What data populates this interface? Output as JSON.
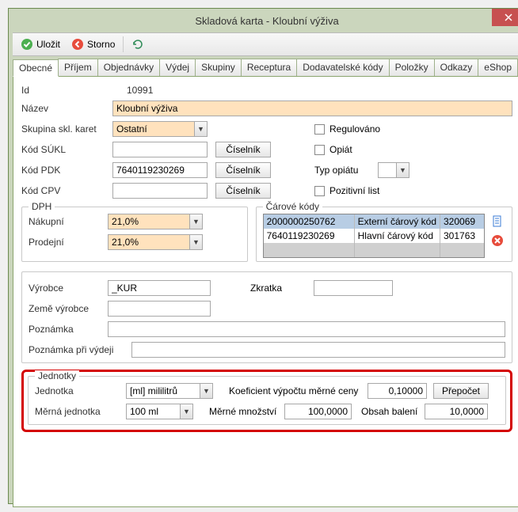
{
  "window": {
    "title": "Skladová karta - Kloubní výživa"
  },
  "toolbar": {
    "save": "Uložit",
    "cancel": "Storno"
  },
  "tabs": [
    "Obecné",
    "Příjem",
    "Objednávky",
    "Výdej",
    "Skupiny",
    "Receptura",
    "Dodavatelské kódy",
    "Položky",
    "Odkazy",
    "eShop"
  ],
  "labels": {
    "id": "Id",
    "nazev": "Název",
    "skupina": "Skupina skl. karet",
    "kodSukl": "Kód SÚKL",
    "kodPdk": "Kód PDK",
    "kodCpv": "Kód CPV",
    "ciselnik": "Číselník",
    "regulovano": "Regulováno",
    "opiat": "Opiát",
    "typOpiatu": "Typ opiátu",
    "pozList": "Pozitivní list",
    "dph": "DPH",
    "nakupni": "Nákupní",
    "prodejni": "Prodejní",
    "carove": "Čárové kódy",
    "vyrobce": "Výrobce",
    "zkratka": "Zkratka",
    "zemeVyrobce": "Země výrobce",
    "poznamka": "Poznámka",
    "poznamkaVydej": "Poznámka při výdeji",
    "jednotky": "Jednotky",
    "jednotka": "Jednotka",
    "koef": "Koeficient výpočtu měrné ceny",
    "prepocet": "Přepočet",
    "mernaJednotka": "Měrná jednotka",
    "merneMnozstvi": "Měrné množství",
    "obsahBaleni": "Obsah balení"
  },
  "values": {
    "id": "10991",
    "nazev": "Kloubní výživa",
    "skupina": "Ostatní",
    "kodSukl": "",
    "kodPdk": "7640119230269",
    "kodCpv": "",
    "typOpiatu": "",
    "dphNakupni": "21,0%",
    "dphProdejni": "21,0%",
    "vyrobce": "_KUR",
    "zkratka": "",
    "zemeVyrobce": "",
    "poznamka": "",
    "poznamkaVydej": "",
    "jednotka": "[ml] mililitrů",
    "koef": "0,10000",
    "mernaJednotka": "100 ml",
    "merneMnozstvi": "100,0000",
    "obsahBaleni": "10,0000"
  },
  "barcodes": [
    {
      "code": "2000000250762",
      "type": "Externí čárový kód",
      "id": "320069"
    },
    {
      "code": "7640119230269",
      "type": "Hlavní čárový kód",
      "id": "301763"
    }
  ]
}
